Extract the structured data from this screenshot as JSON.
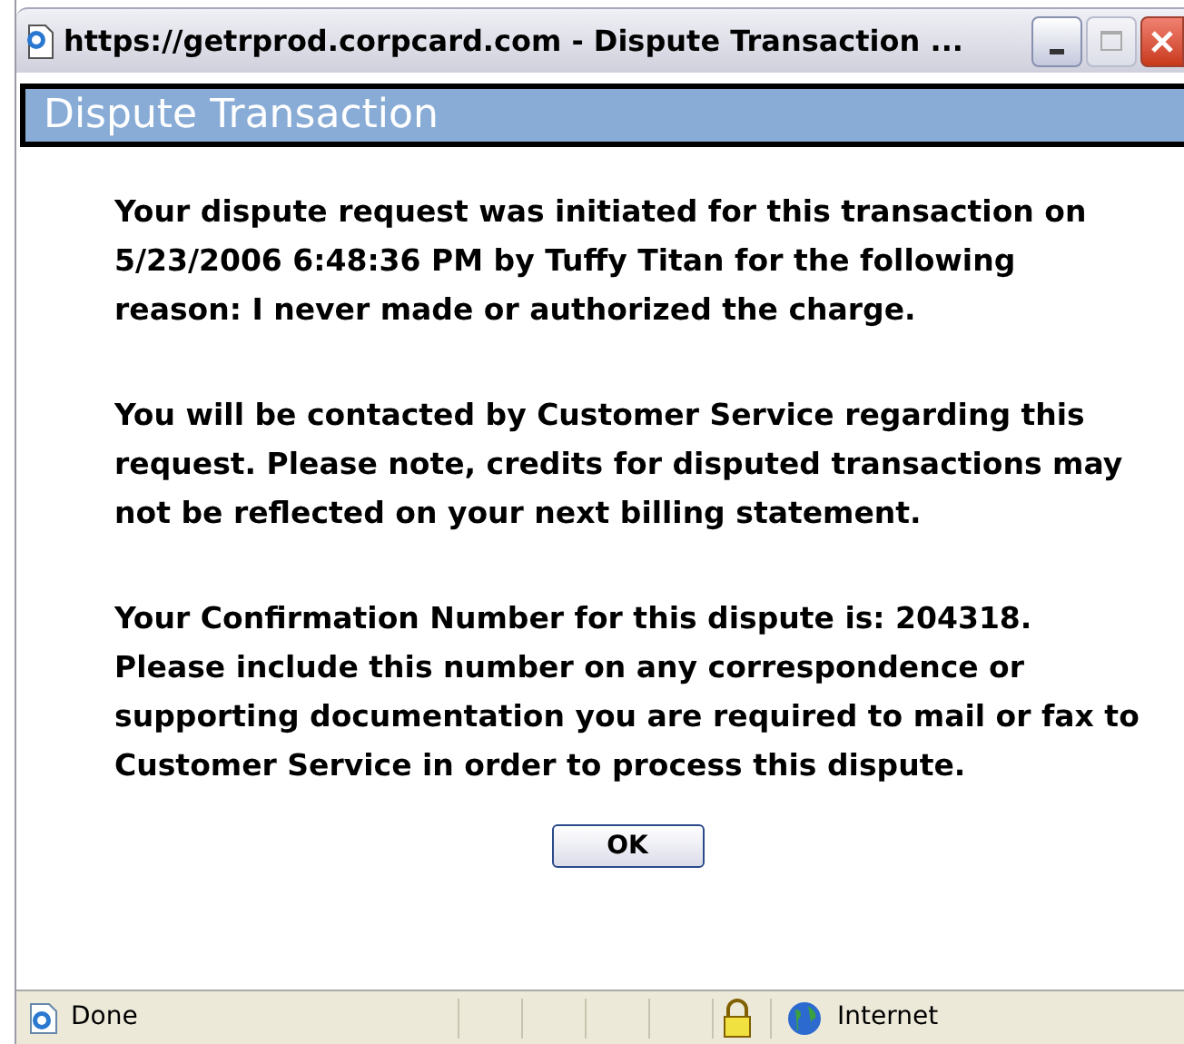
{
  "window": {
    "title": "https://getrprod.corpcard.com - Dispute Transaction ..."
  },
  "dialog": {
    "heading": "Dispute Transaction",
    "paragraphs": [
      "Your dispute request was initiated for this transaction on 5/23/2006 6:48:36 PM by Tuffy Titan for the following reason: I never made or authorized the charge.",
      "You will be contacted by Customer Service regarding this request. Please note, credits for disputed transactions may not be reflected on your next billing statement.",
      "Your Confirmation Number for this dispute is: 204318. Please include this number on any correspondence or supporting documentation you are required to mail or fax to Customer Service in order to process this dispute."
    ],
    "button": "OK"
  },
  "status_bar": {
    "status": "Done",
    "zone": "Internet"
  }
}
